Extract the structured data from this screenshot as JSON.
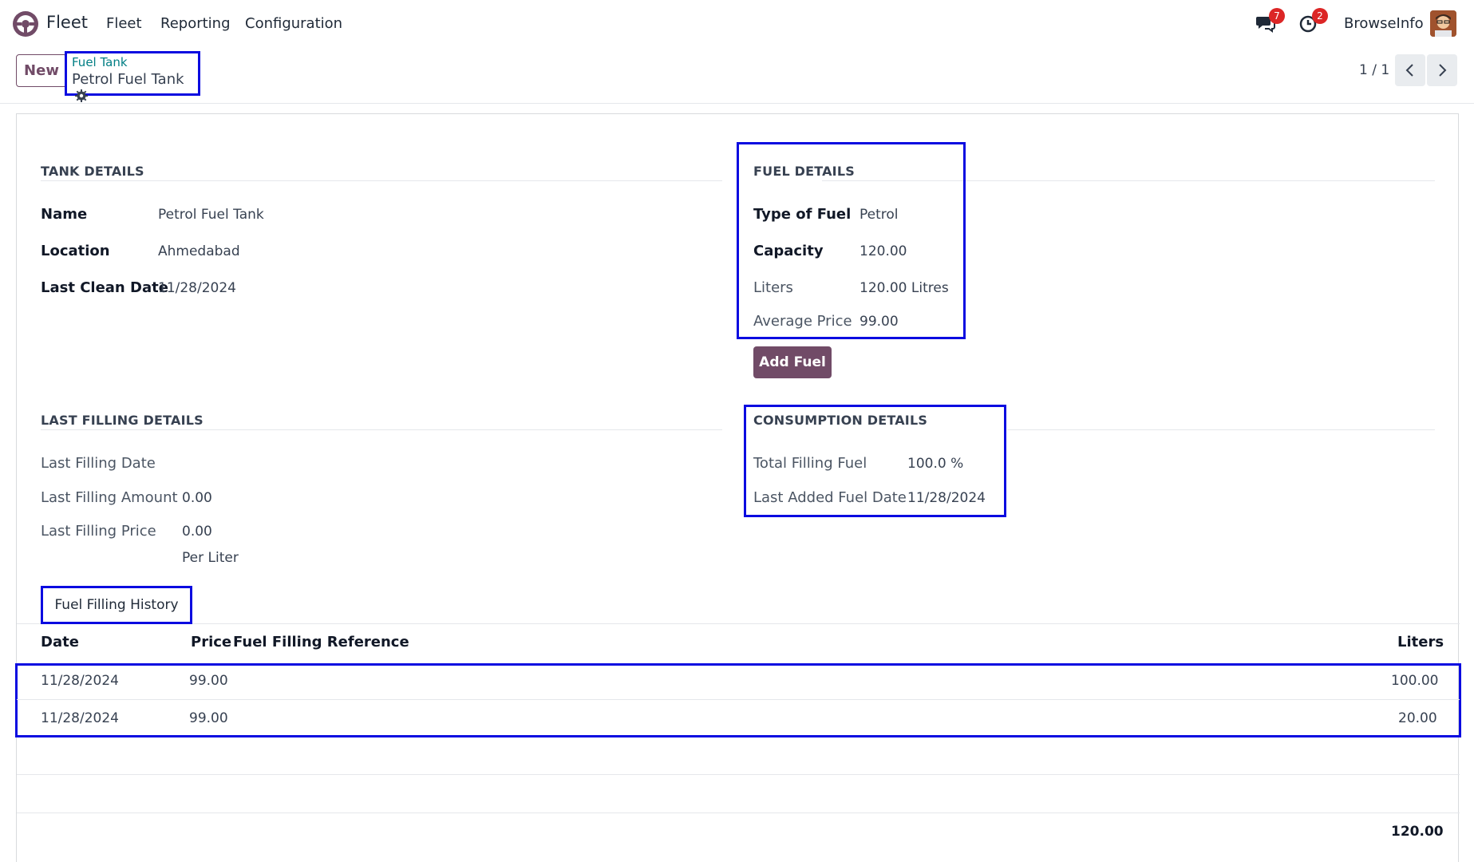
{
  "navbar": {
    "app_name": "Fleet",
    "menus": [
      "Fleet",
      "Reporting",
      "Configuration"
    ],
    "messages_count": "7",
    "activities_count": "2",
    "company": "BrowseInfo"
  },
  "control": {
    "new_label": "New",
    "breadcrumb_parent": "Fuel Tank",
    "breadcrumb_current": "Petrol Fuel Tank",
    "pager": "1 / 1"
  },
  "tank_details": {
    "title": "TANK DETAILS",
    "fields": [
      {
        "label": "Name",
        "value": "Petrol Fuel Tank"
      },
      {
        "label": "Location",
        "value": "Ahmedabad"
      },
      {
        "label": "Last Clean Date",
        "value": "11/28/2024"
      }
    ]
  },
  "fuel_details": {
    "title": "FUEL DETAILS",
    "fields": [
      {
        "label": "Type of Fuel",
        "value": "Petrol"
      },
      {
        "label": "Capacity",
        "value": "120.00"
      },
      {
        "label": "Liters",
        "value": "120.00 Litres"
      },
      {
        "label": "Average Price",
        "value": "99.00"
      }
    ],
    "add_fuel_label": "Add Fuel"
  },
  "last_filling": {
    "title": "LAST FILLING DETAILS",
    "fields": [
      {
        "label": "Last Filling Date",
        "value": ""
      },
      {
        "label": "Last Filling Amount",
        "value": "0.00"
      },
      {
        "label": "Last Filling Price",
        "value": "0.00"
      }
    ],
    "price_unit": "Per Liter"
  },
  "consumption": {
    "title": "CONSUMPTION DETAILS",
    "fields": [
      {
        "label": "Total Filling Fuel",
        "value": "100.0 %"
      },
      {
        "label": "Last Added Fuel Date",
        "value": "11/28/2024"
      }
    ]
  },
  "history": {
    "tab_label": "Fuel Filling History",
    "columns": [
      "Date",
      "Price",
      "Fuel Filling Reference",
      "Liters"
    ],
    "rows": [
      {
        "date": "11/28/2024",
        "price": "99.00",
        "reference": "",
        "liters": "100.00"
      },
      {
        "date": "11/28/2024",
        "price": "99.00",
        "reference": "",
        "liters": "20.00"
      }
    ],
    "total_liters": "120.00"
  },
  "colors": {
    "brand": "#714b67",
    "highlight": "#0b0be0",
    "link": "#017e84"
  }
}
